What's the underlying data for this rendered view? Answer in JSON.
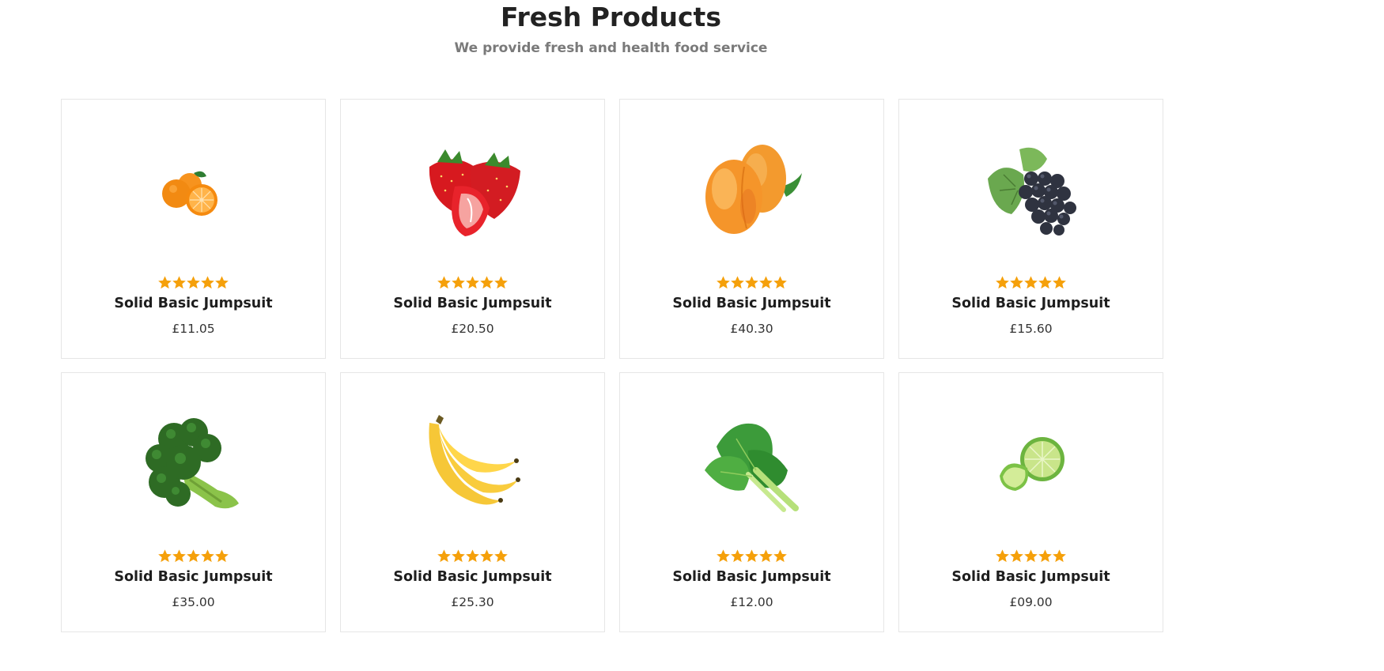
{
  "section": {
    "title": "Fresh Products",
    "subtitle": "We provide fresh and health food service"
  },
  "colors": {
    "star": "#f5a00a",
    "card_border": "#e6e6e6",
    "subtitle": "#7a7a7a"
  },
  "products": [
    {
      "name": "Solid Basic Jumpsuit",
      "price": "£11.05",
      "rating": 5,
      "image_icon": "orange-icon"
    },
    {
      "name": "Solid Basic Jumpsuit",
      "price": "£20.50",
      "rating": 5,
      "image_icon": "strawberry-icon"
    },
    {
      "name": "Solid Basic Jumpsuit",
      "price": "£40.30",
      "rating": 5,
      "image_icon": "peach-icon"
    },
    {
      "name": "Solid Basic Jumpsuit",
      "price": "£15.60",
      "rating": 5,
      "image_icon": "grapes-icon"
    },
    {
      "name": "Solid Basic Jumpsuit",
      "price": "£35.00",
      "rating": 5,
      "image_icon": "broccoli-icon"
    },
    {
      "name": "Solid Basic Jumpsuit",
      "price": "£25.30",
      "rating": 5,
      "image_icon": "banana-icon"
    },
    {
      "name": "Solid Basic Jumpsuit",
      "price": "£12.00",
      "rating": 5,
      "image_icon": "lettuce-icon"
    },
    {
      "name": "Solid Basic Jumpsuit",
      "price": "£09.00",
      "rating": 5,
      "image_icon": "lime-icon"
    }
  ]
}
